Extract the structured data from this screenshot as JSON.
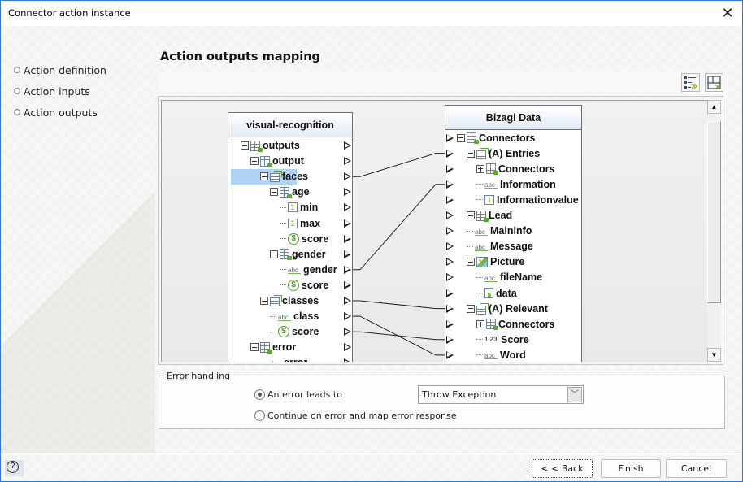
{
  "window": {
    "title": "Connector action instance",
    "close_icon": "close-icon"
  },
  "steps": [
    {
      "label": "Action definition"
    },
    {
      "label": "Action inputs"
    },
    {
      "label": "Action outputs"
    }
  ],
  "page": {
    "title": "Action outputs mapping"
  },
  "toolbar": {
    "buttons": [
      {
        "icon": "auto-map-icon",
        "tooltip": ""
      },
      {
        "icon": "fit-layout-icon",
        "tooltip": ""
      }
    ]
  },
  "source_tree": {
    "title": "visual-recognition",
    "nodes": [
      {
        "label": "outputs",
        "icon": "collection-grid",
        "level": 0,
        "expander": "minus"
      },
      {
        "label": "output",
        "icon": "collection-grid",
        "level": 1,
        "expander": "minus"
      },
      {
        "label": "faces",
        "icon": "collection-list",
        "level": 2,
        "expander": "minus",
        "selected": true
      },
      {
        "label": "age",
        "icon": "collection-grid",
        "level": 3,
        "expander": "minus"
      },
      {
        "label": "min",
        "icon": "integer",
        "level": 4
      },
      {
        "label": "max",
        "icon": "integer",
        "level": 4
      },
      {
        "label": "score",
        "icon": "currency",
        "level": 4
      },
      {
        "label": "gender",
        "icon": "collection-grid",
        "level": 3,
        "expander": "minus"
      },
      {
        "label": "gender",
        "icon": "string",
        "level": 4
      },
      {
        "label": "score",
        "icon": "currency",
        "level": 4
      },
      {
        "label": "classes",
        "icon": "collection-list",
        "level": 2,
        "expander": "minus"
      },
      {
        "label": "class",
        "icon": "string",
        "level": 3
      },
      {
        "label": "score",
        "icon": "currency",
        "level": 3
      },
      {
        "label": "error",
        "icon": "collection-grid",
        "level": 1,
        "expander": "minus"
      },
      {
        "label": "error",
        "icon": "string",
        "level": 2
      }
    ]
  },
  "target_tree": {
    "title": "Bizagi Data",
    "nodes": [
      {
        "label": "Connectors",
        "icon": "entity",
        "level": 0,
        "expander": "minus"
      },
      {
        "label": "(A) Entries",
        "icon": "collection-list",
        "level": 1,
        "expander": "minus"
      },
      {
        "label": "Connectors",
        "icon": "collection-grid",
        "level": 2,
        "expander": "plus"
      },
      {
        "label": "Information",
        "icon": "string",
        "level": 2
      },
      {
        "label": "Informationvalue",
        "icon": "integer",
        "level": 2
      },
      {
        "label": "Lead",
        "icon": "collection-grid",
        "level": 1,
        "expander": "plus"
      },
      {
        "label": "Maininfo",
        "icon": "string",
        "level": 1
      },
      {
        "label": "Message",
        "icon": "string",
        "level": 1
      },
      {
        "label": "Picture",
        "icon": "image",
        "level": 1,
        "expander": "minus"
      },
      {
        "label": "fileName",
        "icon": "string",
        "level": 2
      },
      {
        "label": "data",
        "icon": "file",
        "level": 2
      },
      {
        "label": "(A) Relevant",
        "icon": "collection-list",
        "level": 1,
        "expander": "minus"
      },
      {
        "label": "Connectors",
        "icon": "collection-grid",
        "level": 2,
        "expander": "plus"
      },
      {
        "label": "Score",
        "icon": "decimal",
        "level": 2
      },
      {
        "label": "Word",
        "icon": "string",
        "level": 2
      }
    ]
  },
  "mappings": [
    {
      "from": 2,
      "to": 1
    },
    {
      "from": 8,
      "to": 3
    },
    {
      "from": 10,
      "to": 11
    },
    {
      "from": 11,
      "to": 14
    },
    {
      "from": 12,
      "to": 13
    }
  ],
  "error_handling": {
    "legend": "Error handling",
    "option1_label": "An error leads to",
    "option1_selected": true,
    "option2_label": "Continue on error and map error response",
    "option2_selected": false,
    "select_value": "Throw Exception"
  },
  "footer": {
    "help_icon": "help-icon",
    "back_label": "< < Back",
    "finish_label": "Finish",
    "cancel_label": "Cancel"
  }
}
